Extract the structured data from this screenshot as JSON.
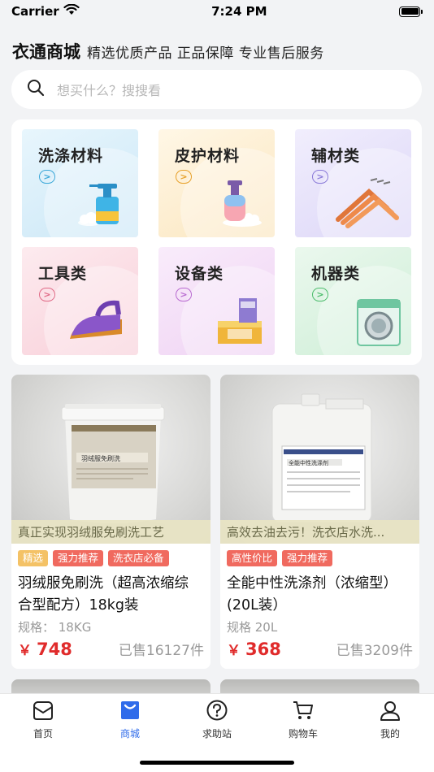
{
  "status": {
    "carrier": "Carrier",
    "time": "7:24 PM"
  },
  "header": {
    "brand": "衣通商城",
    "slogan": "精选优质产品  正品保障  专业售后服务"
  },
  "search": {
    "placeholder": "想买什么？搜搜看"
  },
  "categories": [
    {
      "label": "洗涤材料",
      "icon": "detergent-bottle-icon",
      "bg": "#dff0fa",
      "accent": "#3aa7d8"
    },
    {
      "label": "皮护材料",
      "icon": "lotion-bottle-icon",
      "bg": "#fdf1da",
      "accent": "#e7a028"
    },
    {
      "label": "辅材类",
      "icon": "hangers-icon",
      "bg": "#ece9fb",
      "accent": "#8a7ad8"
    },
    {
      "label": "工具类",
      "icon": "iron-icon",
      "bg": "#fde4ea",
      "accent": "#e06a86"
    },
    {
      "label": "设备类",
      "icon": "press-machine-icon",
      "bg": "#f6e4f8",
      "accent": "#b86ad0"
    },
    {
      "label": "机器类",
      "icon": "washing-machine-icon",
      "bg": "#e0f5e5",
      "accent": "#4dbd6d"
    }
  ],
  "products": [
    {
      "banner": "真正实现羽绒服免刷洗工艺",
      "tags": [
        {
          "text": "精选",
          "color": "yellow"
        },
        {
          "text": "强力推荐",
          "color": "red"
        },
        {
          "text": "洗衣店必备",
          "color": "red"
        }
      ],
      "name": "羽绒服免刷洗（超高浓缩综合型配方）18kg装",
      "spec": "规格： 18KG",
      "yen": "￥",
      "price": "748",
      "sold": "已售16127件",
      "label_on_product": "羽绒服免刷洗"
    },
    {
      "banner": "高效去油去污！洗衣店水洗...",
      "tags": [
        {
          "text": "高性价比",
          "color": "red"
        },
        {
          "text": "强力推荐",
          "color": "red"
        }
      ],
      "name": "全能中性洗涤剂（浓缩型）(20L装）",
      "spec": "规格 20L",
      "yen": "￥",
      "price": "368",
      "sold": "已售3209件",
      "label_on_product": "全能中性洗涤剂"
    }
  ],
  "tabbar": [
    {
      "label": "首页",
      "icon": "home-icon",
      "active": false
    },
    {
      "label": "商城",
      "icon": "mall-bag-icon",
      "active": true
    },
    {
      "label": "求助站",
      "icon": "help-icon",
      "active": false
    },
    {
      "label": "购物车",
      "icon": "cart-icon",
      "active": false
    },
    {
      "label": "我的",
      "icon": "profile-icon",
      "active": false
    }
  ],
  "colors": {
    "accent": "#2f6bea",
    "price": "#e02b2b",
    "tag_red": "#f06a5f",
    "tag_yellow": "#f4c266"
  }
}
